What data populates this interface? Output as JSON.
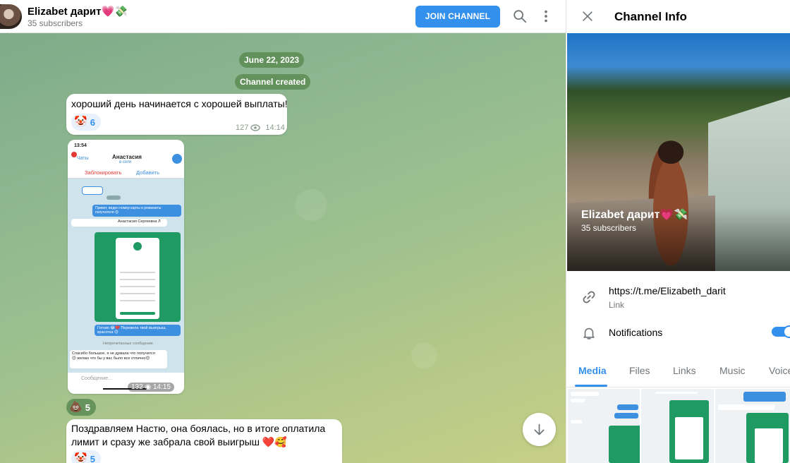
{
  "header": {
    "channel_title": "Elizabet дарит💗💸",
    "subscribers": "35 subscribers",
    "join_label": "JOIN CHANNEL"
  },
  "chat": {
    "date_pill": "June 22, 2023",
    "service_pill": "Channel created",
    "messages": [
      {
        "text": "хороший день начинается с хорошей выплаты!",
        "reaction_emoji": "🤡",
        "reaction_count": "6",
        "views": "127",
        "time": "14:14"
      },
      {
        "type": "photo",
        "views": "132",
        "time": "14:15",
        "reaction_emoji": "💩",
        "reaction_count": "5",
        "screenshot": {
          "status_time": "13:54",
          "back_label": "Чаты",
          "contact_name": "Анастасия",
          "contact_status": "в сети",
          "block_label": "Заблокировать",
          "add_label": "Добавить",
          "bubble_1": "Привет, видел номер карты и реквизиты получателя 😊",
          "forward_label": "Анастасия Сергеевна Л",
          "reply_text": "Готово 😂💔 Перевела твой выигрыш, красотка 😊",
          "unread_label": "Непрочитанные сообщения",
          "incoming_text": "Спасибо большое, я не думала что получится😊 желаю что бы у вас было все отлично😊",
          "input_placeholder": "Сообщение..."
        }
      },
      {
        "text": "Поздравляем Настю, она боялась, но в итоге оплатила лимит и сразу же забрала свой выигрыш ❤️🥰",
        "reaction_emoji": "🤡",
        "reaction_count": "5"
      }
    ]
  },
  "info": {
    "title": "Channel Info",
    "hero_title": "Elizabet дарит💗💸",
    "hero_subscribers": "35 subscribers",
    "link": "https://t.me/Elizabeth_darit",
    "link_caption": "Link",
    "notifications_label": "Notifications",
    "notifications_on": true,
    "tabs": [
      "Media",
      "Files",
      "Links",
      "Music",
      "Voice"
    ],
    "active_tab": "Media"
  },
  "colors": {
    "accent": "#3390ec",
    "pill": "#5c8c54",
    "chat_green": "#8fb890"
  }
}
